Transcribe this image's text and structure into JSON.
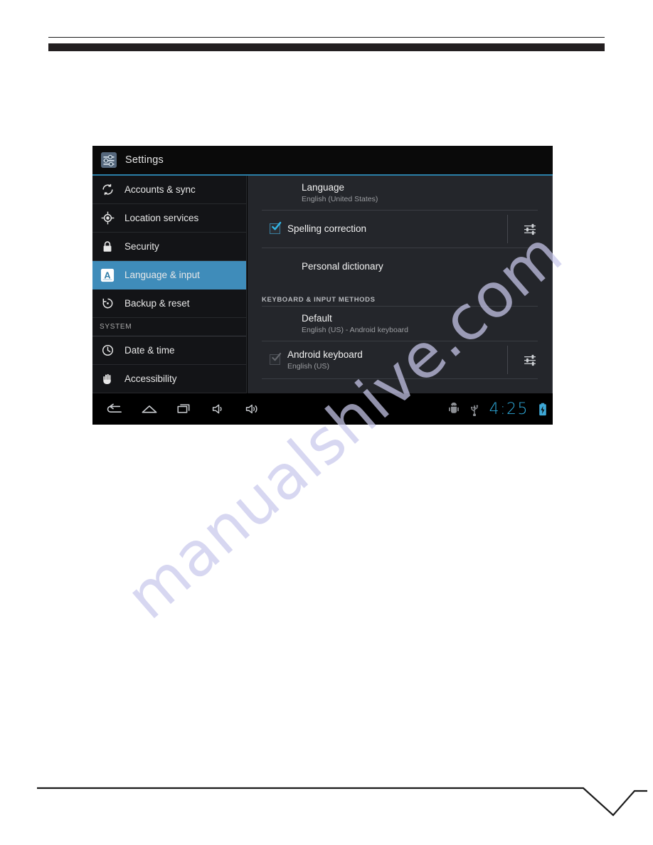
{
  "window": {
    "title": "Settings",
    "title_icon": "settings-sliders-icon"
  },
  "sidebar": {
    "items": [
      {
        "label": "Accounts & sync",
        "icon": "sync-icon",
        "active": false
      },
      {
        "label": "Location services",
        "icon": "location-crosshair-icon",
        "active": false
      },
      {
        "label": "Security",
        "icon": "lock-icon",
        "active": false
      },
      {
        "label": "Language & input",
        "icon": "letter-a-icon",
        "active": true
      },
      {
        "label": "Backup & reset",
        "icon": "backup-restore-icon",
        "active": false
      }
    ],
    "section_label": "SYSTEM",
    "system_items": [
      {
        "label": "Date & time",
        "icon": "clock-icon",
        "active": false
      },
      {
        "label": "Accessibility",
        "icon": "hand-icon",
        "active": false
      }
    ]
  },
  "content": {
    "rows": [
      {
        "title": "Language",
        "subtitle": "English (United States)",
        "checkbox": "none",
        "slider": false
      },
      {
        "title": "Spelling correction",
        "subtitle": "",
        "checkbox": "checked",
        "slider": true
      },
      {
        "title": "Personal dictionary",
        "subtitle": "",
        "checkbox": "none",
        "slider": false
      }
    ],
    "section_header": "KEYBOARD & INPUT METHODS",
    "keyboard_rows": [
      {
        "title": "Default",
        "subtitle": "English (US) - Android keyboard",
        "checkbox": "none",
        "slider": false
      },
      {
        "title": "Android keyboard",
        "subtitle": "English (US)",
        "checkbox": "disabled-checked",
        "slider": true
      }
    ]
  },
  "navbar": {
    "left_icons": [
      {
        "name": "back-icon"
      },
      {
        "name": "home-icon"
      },
      {
        "name": "recents-icon"
      },
      {
        "name": "volume-down-icon"
      },
      {
        "name": "volume-up-icon"
      }
    ],
    "right_icons": [
      {
        "name": "android-debug-icon"
      },
      {
        "name": "usb-icon"
      }
    ],
    "clock": "4:25",
    "battery_icon": "battery-charging-icon"
  },
  "watermark": {
    "text": "manualshive.com"
  },
  "colors": {
    "accent_blue": "#3f8cba",
    "clock_cyan": "#2ea8d8",
    "checkbox_blue": "#33b5e5",
    "panel_bg": "#24262b",
    "sidebar_bg": "#131417"
  }
}
